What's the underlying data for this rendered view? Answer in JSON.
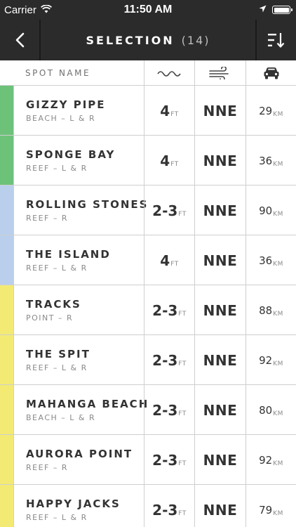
{
  "status_bar": {
    "carrier": "Carrier",
    "time": "11:50 AM",
    "battery_level": 1.0
  },
  "nav": {
    "title": "SELECTION",
    "count": "(14)"
  },
  "header": {
    "spot_name": "SPOT NAME",
    "wave_icon": "wave-icon",
    "wind_icon": "wind-icon",
    "car_icon": "car-icon"
  },
  "colors": {
    "green": "#6dc27a",
    "blue": "#b9cfec",
    "yellow": "#f3ea74",
    "dark": "#2b2b2b"
  },
  "spots": [
    {
      "name": "GIZZY PIPE",
      "type": "BEACH – L & R",
      "wave": "4",
      "wave_unit": "FT",
      "wind": "NNE",
      "distance": "29",
      "distance_unit": "KM",
      "color": "#6dc27a"
    },
    {
      "name": "SPONGE BAY",
      "type": "REEF – L & R",
      "wave": "4",
      "wave_unit": "FT",
      "wind": "NNE",
      "distance": "36",
      "distance_unit": "KM",
      "color": "#6dc27a"
    },
    {
      "name": "ROLLING STONES",
      "type": "REEF – R",
      "wave": "2-3",
      "wave_unit": "FT",
      "wind": "NNE",
      "distance": "90",
      "distance_unit": "KM",
      "color": "#b9cfec"
    },
    {
      "name": "THE ISLAND",
      "type": "REEF – L & R",
      "wave": "4",
      "wave_unit": "FT",
      "wind": "NNE",
      "distance": "36",
      "distance_unit": "KM",
      "color": "#b9cfec"
    },
    {
      "name": "TRACKS",
      "type": "POINT – R",
      "wave": "2-3",
      "wave_unit": "FT",
      "wind": "NNE",
      "distance": "88",
      "distance_unit": "KM",
      "color": "#f3ea74"
    },
    {
      "name": "THE SPIT",
      "type": "REEF – L & R",
      "wave": "2-3",
      "wave_unit": "FT",
      "wind": "NNE",
      "distance": "92",
      "distance_unit": "KM",
      "color": "#f3ea74"
    },
    {
      "name": "MAHANGA BEACH",
      "type": "BEACH – L & R",
      "wave": "2-3",
      "wave_unit": "FT",
      "wind": "NNE",
      "distance": "80",
      "distance_unit": "KM",
      "color": "#f3ea74"
    },
    {
      "name": "AURORA POINT",
      "type": "REEF – R",
      "wave": "2-3",
      "wave_unit": "FT",
      "wind": "NNE",
      "distance": "92",
      "distance_unit": "KM",
      "color": "#f3ea74"
    },
    {
      "name": "HAPPY JACKS",
      "type": "REEF – L & R",
      "wave": "2-3",
      "wave_unit": "FT",
      "wind": "NNE",
      "distance": "79",
      "distance_unit": "KM",
      "color": "#f3ea74"
    }
  ]
}
